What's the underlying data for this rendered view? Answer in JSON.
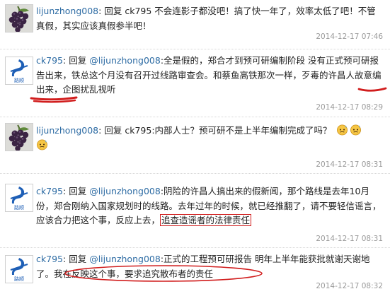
{
  "comments": [
    {
      "user": "lijunzhong008",
      "sep": ":",
      "reply_word": "回复",
      "target": "ck795",
      "text": "不会连影子都没吧！搞了快一年了，效率太低了吧！不管真假，其实应该真假参半吧！",
      "time": "2014-12-17 07:46",
      "avatar": "grapes-avatar"
    },
    {
      "user": "ck795",
      "sep": ":",
      "reply_word": "回复",
      "mention": "@lijunzhong008",
      "text_a": "全是假的，郑合才到预可研编制阶段 没有正式预可研报告出来，铁总这个月没有召开过线路审查会。和蔡鱼高铁那次一样，",
      "text_hl1": "歹毒的许昌人",
      "text_b": "故意编出来，企图扰乱视听",
      "time": "2014-12-17 08:29",
      "avatar": "railway-logo-avatar",
      "logo_text": "路顺"
    },
    {
      "user": "lijunzhong008",
      "sep": ":",
      "reply_word": "回复",
      "target": "ck795",
      "text": "内部人士？预可研不是上半年编制完成了吗？",
      "time": "2014-12-17 08:31",
      "avatar": "grapes-avatar"
    },
    {
      "user": "ck795",
      "sep": ":",
      "reply_word": "回复",
      "mention": "@lijunzhong008",
      "text_a": "阴险的许昌人搞出来的假新闻，那个路线是去年10月份，郑合刚纳入国家规划时的线路。去年过年的时候，就已经推翻了，请不要轻信谣言，应该合力把这个事，反应上去，",
      "text_box": "追查造谣者的法律责任",
      "time": "2014-12-17 08:31",
      "avatar": "railway-logo-avatar",
      "logo_text": "路顺"
    },
    {
      "user": "ck795",
      "sep": ":",
      "reply_word": "回复",
      "mention": "@lijunzhong008",
      "text_a": "正式的工程预可研报告 明年上半年能获批就谢天谢地了。",
      "text_circ": "我在反映这个事，要求追究散布者的责任",
      "time": "2014-12-17 08:32",
      "avatar": "railway-logo-avatar",
      "logo_text": "路顺"
    }
  ],
  "colors": {
    "link": "#2e6ca4",
    "text": "#222222",
    "time": "#9a9a9a",
    "annotation": "#d11d1d",
    "logo_blue": "#1e5fb6"
  }
}
